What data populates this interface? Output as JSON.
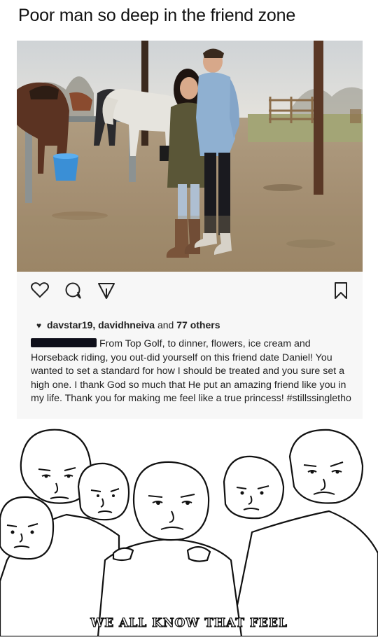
{
  "header": {
    "title": "Poor man so deep in the friend zone"
  },
  "post": {
    "photo_icon": "couple-with-horses-photo",
    "actions": {
      "like_icon": "heart-outline-icon",
      "comment_icon": "comment-bubble-icon",
      "share_icon": "send-icon",
      "save_icon": "bookmark-icon"
    },
    "likes": {
      "users": "davstar19, davidhneiva",
      "and": "and",
      "others": "77 others"
    },
    "caption": {
      "text": "From Top Golf, to dinner, flowers, ice cream and Horseback riding, you out-did yourself on this friend date Daniel! You wanted to set a standard for how I should be treated and you sure set a high one. I thank God so much that He put an amazing friend like you in my life. Thank you for making me feel like a true princess! #stillssingletho"
    }
  },
  "meme": {
    "caption": "WE ALL KNOW THAT FEEL",
    "art_icon": "wojak-group-hug-drawing"
  },
  "colors": {
    "background": "#ffffff",
    "post_bg": "#f7f7f7",
    "text": "#222222"
  }
}
